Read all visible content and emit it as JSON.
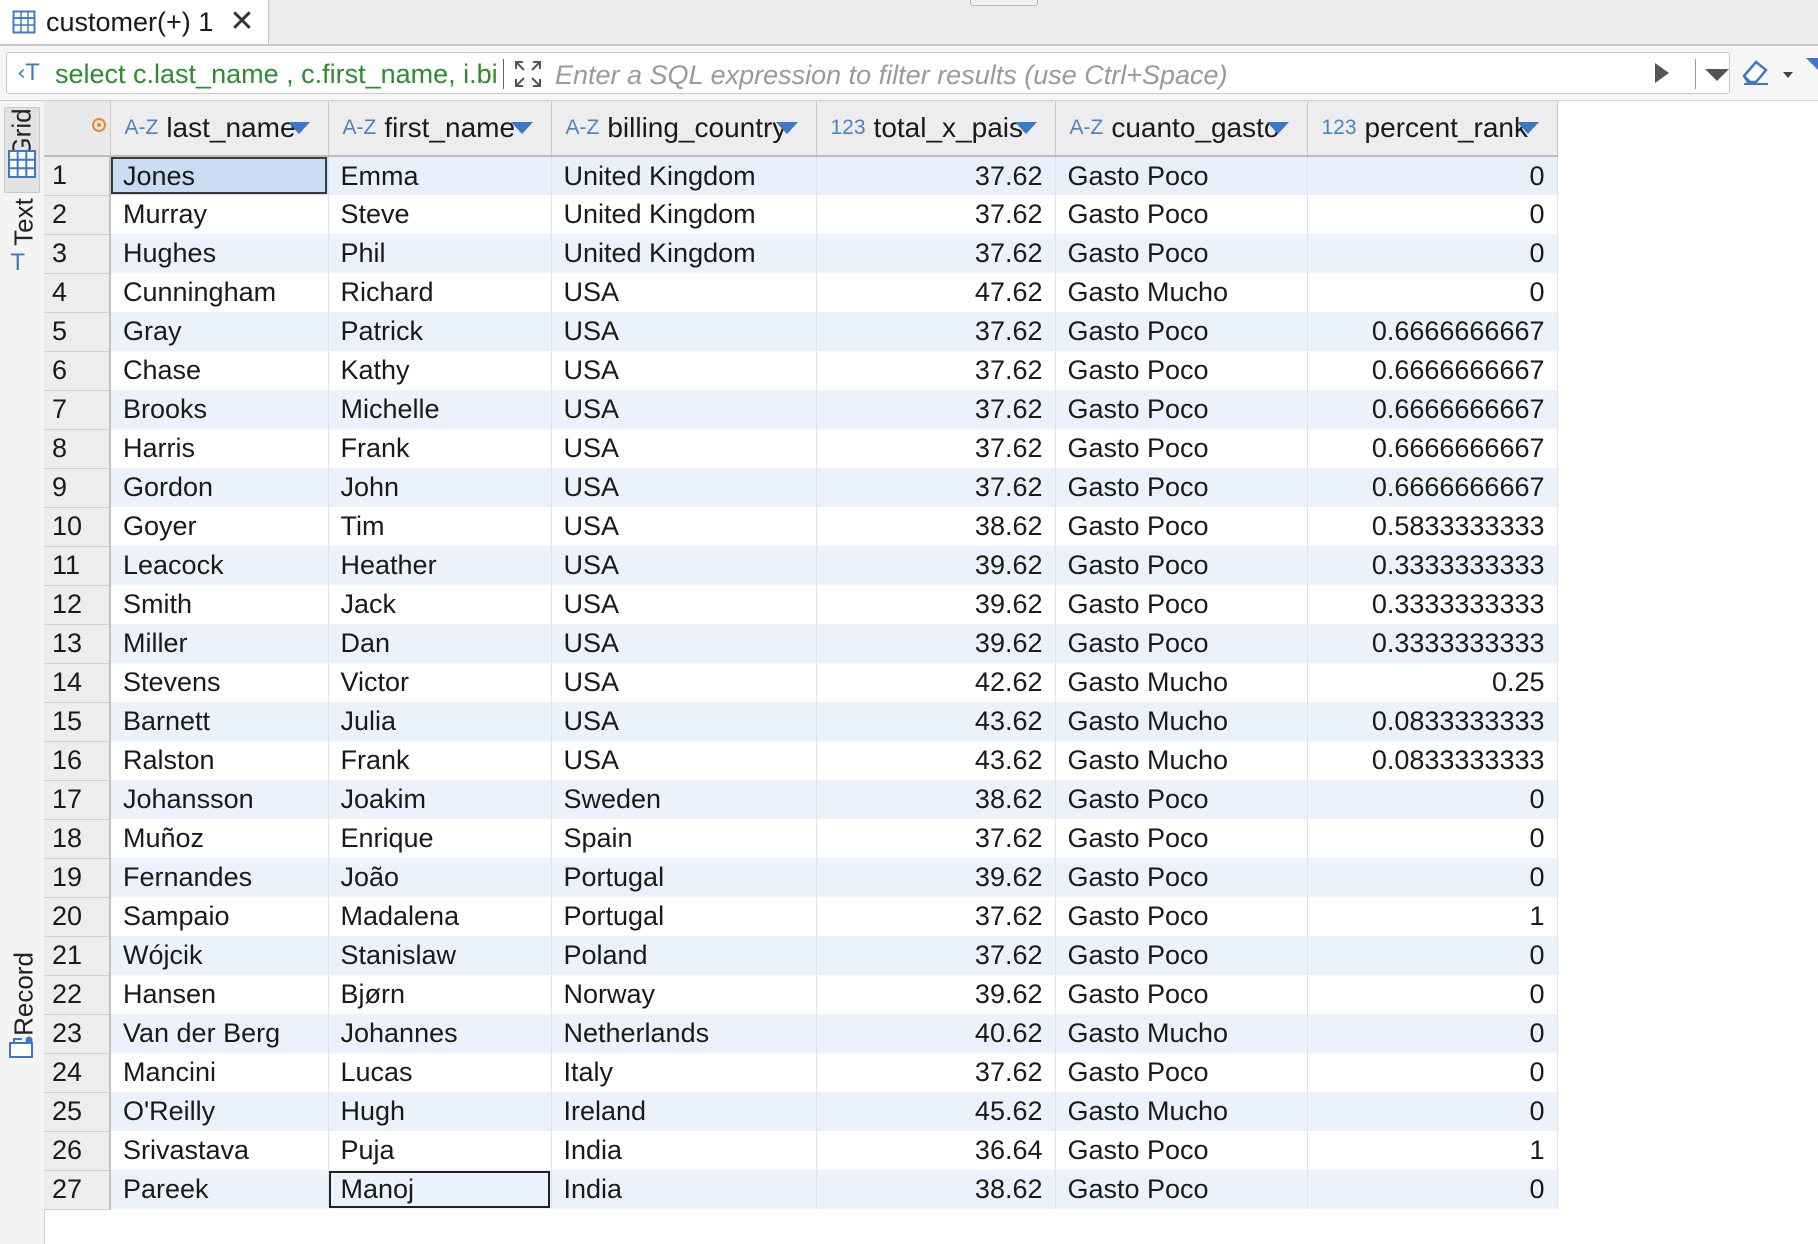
{
  "tab": {
    "title": "customer(+) 1"
  },
  "filter": {
    "sql_preview": "select c.last_name , c.first_name, i.billing_country",
    "placeholder": "Enter a SQL expression to filter results (use Ctrl+Space)"
  },
  "sidebar": {
    "grid_label": "Grid",
    "text_label": "Text",
    "record_label": "Record"
  },
  "columns": [
    {
      "type": "A-Z",
      "name": "last_name"
    },
    {
      "type": "A-Z",
      "name": "first_name"
    },
    {
      "type": "A-Z",
      "name": "billing_country"
    },
    {
      "type": "123",
      "name": "total_x_pais"
    },
    {
      "type": "A-Z",
      "name": "cuanto_gasto"
    },
    {
      "type": "123",
      "name": "percent_rank"
    }
  ],
  "rows": [
    [
      "1",
      "Jones",
      "Emma",
      "United Kingdom",
      "37.62",
      "Gasto Poco",
      "0"
    ],
    [
      "2",
      "Murray",
      "Steve",
      "United Kingdom",
      "37.62",
      "Gasto Poco",
      "0"
    ],
    [
      "3",
      "Hughes",
      "Phil",
      "United Kingdom",
      "37.62",
      "Gasto Poco",
      "0"
    ],
    [
      "4",
      "Cunningham",
      "Richard",
      "USA",
      "47.62",
      "Gasto Mucho",
      "0"
    ],
    [
      "5",
      "Gray",
      "Patrick",
      "USA",
      "37.62",
      "Gasto Poco",
      "0.6666666667"
    ],
    [
      "6",
      "Chase",
      "Kathy",
      "USA",
      "37.62",
      "Gasto Poco",
      "0.6666666667"
    ],
    [
      "7",
      "Brooks",
      "Michelle",
      "USA",
      "37.62",
      "Gasto Poco",
      "0.6666666667"
    ],
    [
      "8",
      "Harris",
      "Frank",
      "USA",
      "37.62",
      "Gasto Poco",
      "0.6666666667"
    ],
    [
      "9",
      "Gordon",
      "John",
      "USA",
      "37.62",
      "Gasto Poco",
      "0.6666666667"
    ],
    [
      "10",
      "Goyer",
      "Tim",
      "USA",
      "38.62",
      "Gasto Poco",
      "0.5833333333"
    ],
    [
      "11",
      "Leacock",
      "Heather",
      "USA",
      "39.62",
      "Gasto Poco",
      "0.3333333333"
    ],
    [
      "12",
      "Smith",
      "Jack",
      "USA",
      "39.62",
      "Gasto Poco",
      "0.3333333333"
    ],
    [
      "13",
      "Miller",
      "Dan",
      "USA",
      "39.62",
      "Gasto Poco",
      "0.3333333333"
    ],
    [
      "14",
      "Stevens",
      "Victor",
      "USA",
      "42.62",
      "Gasto Mucho",
      "0.25"
    ],
    [
      "15",
      "Barnett",
      "Julia",
      "USA",
      "43.62",
      "Gasto Mucho",
      "0.0833333333"
    ],
    [
      "16",
      "Ralston",
      "Frank",
      "USA",
      "43.62",
      "Gasto Mucho",
      "0.0833333333"
    ],
    [
      "17",
      "Johansson",
      "Joakim",
      "Sweden",
      "38.62",
      "Gasto Poco",
      "0"
    ],
    [
      "18",
      "Muñoz",
      "Enrique",
      "Spain",
      "37.62",
      "Gasto Poco",
      "0"
    ],
    [
      "19",
      "Fernandes",
      "João",
      "Portugal",
      "39.62",
      "Gasto Poco",
      "0"
    ],
    [
      "20",
      "Sampaio",
      "Madalena",
      "Portugal",
      "37.62",
      "Gasto Poco",
      "1"
    ],
    [
      "21",
      "Wójcik",
      "Stanislaw",
      "Poland",
      "37.62",
      "Gasto Poco",
      "0"
    ],
    [
      "22",
      "Hansen",
      "Bjørn",
      "Norway",
      "39.62",
      "Gasto Poco",
      "0"
    ],
    [
      "23",
      "Van der Berg",
      "Johannes",
      "Netherlands",
      "40.62",
      "Gasto Mucho",
      "0"
    ],
    [
      "24",
      "Mancini",
      "Lucas",
      "Italy",
      "37.62",
      "Gasto Poco",
      "0"
    ],
    [
      "25",
      "O'Reilly",
      "Hugh",
      "Ireland",
      "45.62",
      "Gasto Mucho",
      "0"
    ],
    [
      "26",
      "Srivastava",
      "Puja",
      "India",
      "36.64",
      "Gasto Poco",
      "1"
    ],
    [
      "27",
      "Pareek",
      "Manoj",
      "India",
      "38.62",
      "Gasto Poco",
      "0"
    ]
  ],
  "colors": {
    "accent": "#3c78c8",
    "row_alt": "#ecf2fb",
    "sql_text": "#2e8b2e",
    "indicator": "#e58a2c"
  }
}
